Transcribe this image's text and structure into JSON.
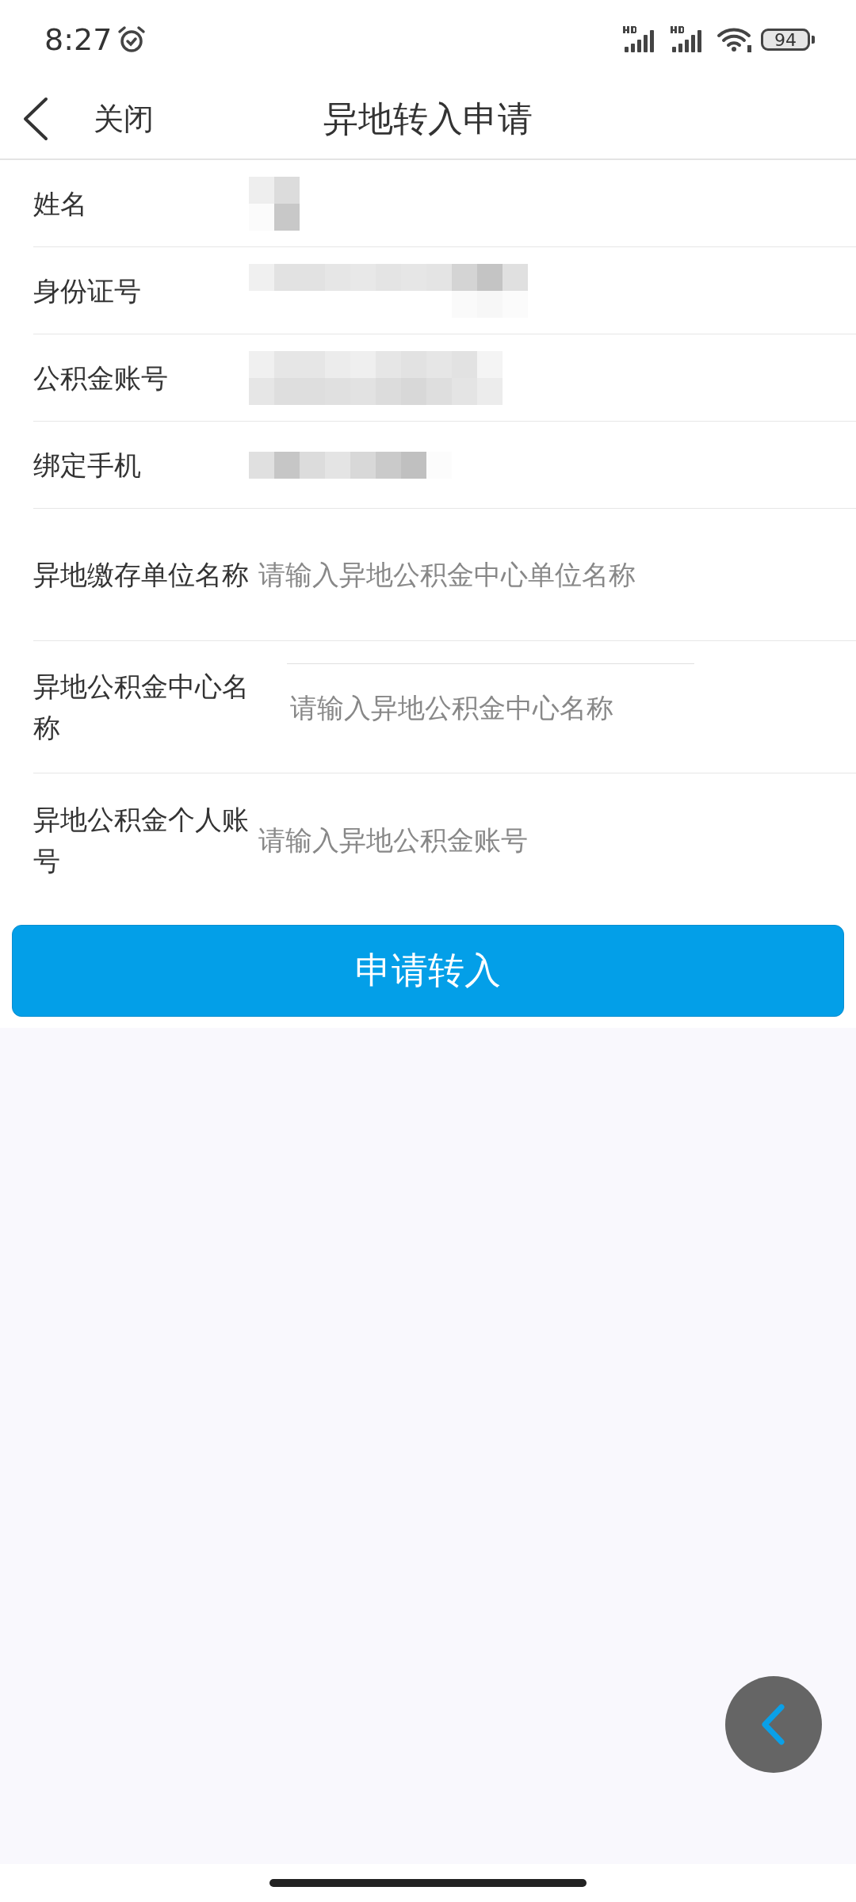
{
  "status_bar": {
    "time": "8:27",
    "battery": "94"
  },
  "header": {
    "back_label": "关闭",
    "title": "异地转入申请"
  },
  "form": {
    "rows": [
      {
        "kind": "readonly",
        "label": "姓名"
      },
      {
        "kind": "readonly",
        "label": "身份证号"
      },
      {
        "kind": "readonly",
        "label": "公积金账号"
      },
      {
        "kind": "readonly",
        "label": "绑定手机"
      },
      {
        "kind": "input",
        "label": "异地缴存单位名称",
        "placeholder": "请输入异地公积金中心单位名称"
      },
      {
        "kind": "input_bordered",
        "label": "异地公积金中心名称",
        "placeholder": "请输入异地公积金中心名称"
      },
      {
        "kind": "input",
        "label": "异地公积金个人账号",
        "placeholder": "请输入异地公积金账号"
      }
    ]
  },
  "submit_button": "申请转入"
}
